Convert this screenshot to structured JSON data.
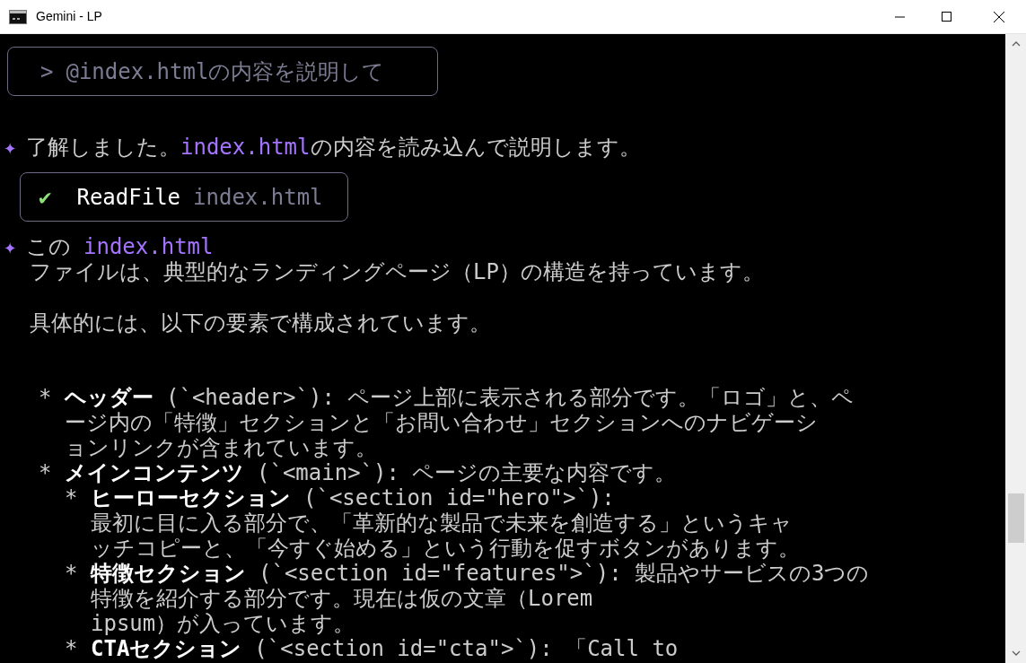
{
  "window": {
    "title": "Gemini - LP"
  },
  "prompt": {
    "marker": ">",
    "text": "@index.htmlの内容を説明して"
  },
  "reply": {
    "marker": "✦",
    "segments": [
      {
        "text": "了解しました。",
        "kind": "plain"
      },
      {
        "text": "index.html",
        "kind": "accent"
      },
      {
        "text": "の内容を読み込んで説明します。",
        "kind": "plain"
      }
    ]
  },
  "tool_call": {
    "status": "✔",
    "name": "ReadFile",
    "argument": "index.html"
  },
  "answer": {
    "marker": "✦",
    "segments": [
      {
        "text": "この",
        "kind": "plain"
      },
      {
        "text": "index.html",
        "kind": "accent"
      }
    ],
    "paragraphs": [
      "ファイルは、典型的なランディングページ（LP）の構造を持っています。",
      "具体的には、以下の要素で構成されています。"
    ],
    "items": [
      {
        "marker": "*",
        "heading": "ヘッダー",
        "lines": [
          "(`<header>`): ページ上部に表示される部分です。「ロゴ」と、ペ",
          "ージ内の「特徴」セクションと「お問い合わせ」セクションへのナビゲーシ",
          "ョンリンクが含まれています。"
        ]
      },
      {
        "marker": "*",
        "heading": "メインコンテンツ",
        "lines": [
          "(`<main>`): ページの主要な内容です。"
        ],
        "children": [
          {
            "marker": "*",
            "heading": "ヒーローセクション",
            "lines": [
              "(`<section id=\"hero\">`):",
              "最初に目に入る部分で、「革新的な製品で未来を創造する」というキャ",
              "ッチコピーと、「今すぐ始める」という行動を促すボタンがあります。"
            ]
          },
          {
            "marker": "*",
            "heading": "特徴セクション",
            "lines": [
              "(`<section id=\"features\">`): 製品やサービスの3つの",
              "特徴を紹介する部分です。現在は仮の文章（Lorem",
              "ipsum）が入っています。"
            ]
          },
          {
            "marker": "*",
            "heading": "CTAセクション",
            "lines": [
              "(`<section id=\"cta\">`): 「Call to"
            ]
          }
        ]
      }
    ]
  }
}
